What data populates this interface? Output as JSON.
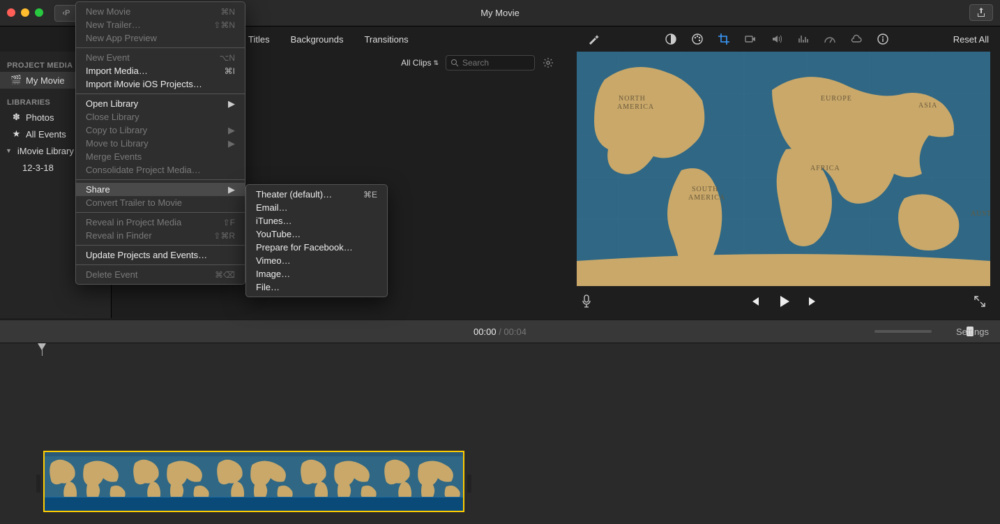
{
  "window": {
    "title": "My Movie"
  },
  "nav_back_label": "P",
  "tabs": {
    "titles": "Titles",
    "backgrounds": "Backgrounds",
    "transitions": "Transitions"
  },
  "toolbar": {
    "reset": "Reset All"
  },
  "search": {
    "allclips": "All Clips",
    "placeholder": "Search"
  },
  "sidebar": {
    "head1": "PROJECT MEDIA",
    "project": "My Movie",
    "head2": "LIBRARIES",
    "photos": "Photos",
    "allevents": "All Events",
    "library": "iMovie Library",
    "event": "12-3-18"
  },
  "preview_controls": {
    "prev": "prev",
    "play": "play",
    "next": "next"
  },
  "timecode": {
    "current": "00:00",
    "sep": " / ",
    "duration": "00:04",
    "settings": "Settings"
  },
  "file_menu": [
    {
      "label": "New Movie",
      "shortcut": "⌘N",
      "disabled": true
    },
    {
      "label": "New Trailer…",
      "shortcut": "⇧⌘N",
      "disabled": true
    },
    {
      "label": "New App Preview",
      "disabled": true
    },
    {
      "sep": true
    },
    {
      "label": "New Event",
      "shortcut": "⌥N",
      "disabled": true
    },
    {
      "label": "Import Media…",
      "shortcut": "⌘I"
    },
    {
      "label": "Import iMovie iOS Projects…"
    },
    {
      "sep": true
    },
    {
      "label": "Open Library",
      "submenu": true
    },
    {
      "label": "Close Library",
      "disabled": true
    },
    {
      "label": "Copy to Library",
      "submenu": true,
      "disabled": true
    },
    {
      "label": "Move to Library",
      "submenu": true,
      "disabled": true
    },
    {
      "label": "Merge Events",
      "disabled": true
    },
    {
      "label": "Consolidate Project Media…",
      "disabled": true
    },
    {
      "sep": true
    },
    {
      "label": "Share",
      "submenu": true,
      "highlighted": true
    },
    {
      "label": "Convert Trailer to Movie",
      "disabled": true
    },
    {
      "sep": true
    },
    {
      "label": "Reveal in Project Media",
      "shortcut": "⇧F",
      "disabled": true
    },
    {
      "label": "Reveal in Finder",
      "shortcut": "⇧⌘R",
      "disabled": true
    },
    {
      "sep": true
    },
    {
      "label": "Update Projects and Events…"
    },
    {
      "sep": true
    },
    {
      "label": "Delete Event",
      "shortcut": "⌘⌫",
      "disabled": true
    }
  ],
  "share_menu": [
    {
      "label": "Theater (default)…",
      "shortcut": "⌘E"
    },
    {
      "label": "Email…"
    },
    {
      "label": "iTunes…"
    },
    {
      "label": "YouTube…"
    },
    {
      "label": "Prepare for Facebook…"
    },
    {
      "label": "Vimeo…"
    },
    {
      "label": "Image…"
    },
    {
      "label": "File…"
    }
  ]
}
